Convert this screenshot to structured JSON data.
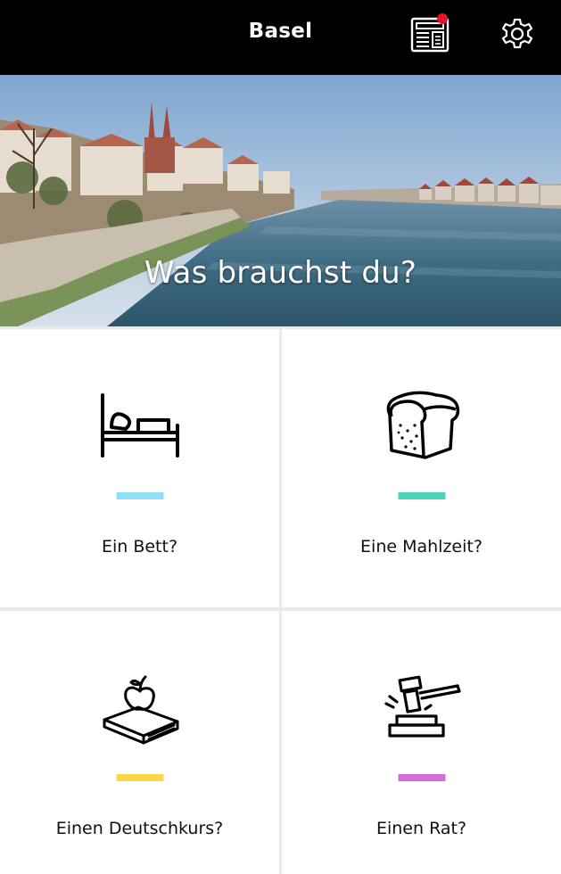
{
  "header": {
    "title": "Basel",
    "news_icon": "newspaper-icon",
    "settings_icon": "gear-icon",
    "notification_color": "#e8132a"
  },
  "hero": {
    "headline": "Was brauchst du?",
    "image": "basel-rhine-river-photo"
  },
  "tiles": [
    {
      "label": "Ein Bett?",
      "icon": "bed-icon",
      "accent": "#8ee0f7"
    },
    {
      "label": "Eine Mahlzeit?",
      "icon": "bread-icon",
      "accent": "#4dd4b9"
    },
    {
      "label": "Einen Deutschkurs?",
      "icon": "book-apple-icon",
      "accent": "#fbd64a"
    },
    {
      "label": "Einen Rat?",
      "icon": "gavel-icon",
      "accent": "#d76ad4"
    }
  ]
}
